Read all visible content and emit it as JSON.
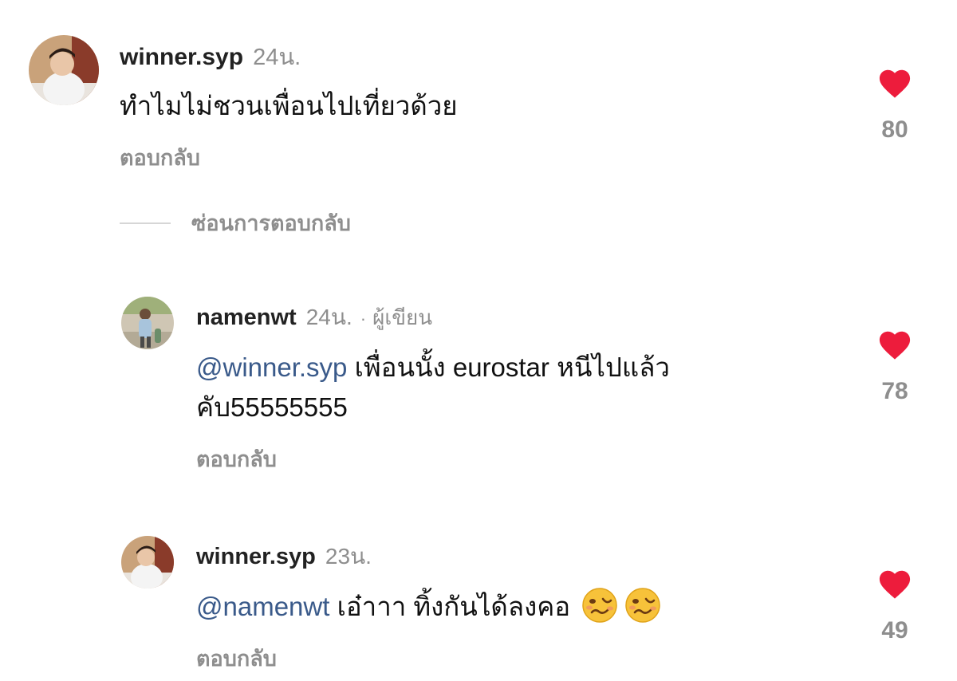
{
  "comments": [
    {
      "username": "winner.syp",
      "time": "24น.",
      "text": "ทำไมไม่ชวนเพื่อนไปเที่ยวด้วย",
      "reply_label": "ตอบกลับ",
      "likes": "80",
      "avatar_icon": "profile-photo"
    }
  ],
  "hide_replies_label": "ซ่อนการตอบกลับ",
  "replies": [
    {
      "username": "namenwt",
      "time": "24น.",
      "separator": "·",
      "author_badge": "ผู้เขียน",
      "mention": "@winner.syp",
      "text_line1": " เพื่อนนั้ง eurostar หนีไปแล้ว",
      "text_line2": "คับ55555555",
      "reply_label": "ตอบกลับ",
      "likes": "78",
      "avatar_icon": "profile-photo"
    },
    {
      "username": "winner.syp",
      "time": "23น.",
      "mention": "@namenwt",
      "text": " เอ๋าาา ทิ้งกันได้ลงคอ",
      "emojis": [
        "woozy-face-emoji",
        "woozy-face-emoji"
      ],
      "reply_label": "ตอบกลับ",
      "likes": "49",
      "avatar_icon": "profile-photo"
    }
  ],
  "colors": {
    "heart": "#ed1c3c",
    "muted": "#8e8e8e",
    "mention": "#3a5a8a"
  }
}
